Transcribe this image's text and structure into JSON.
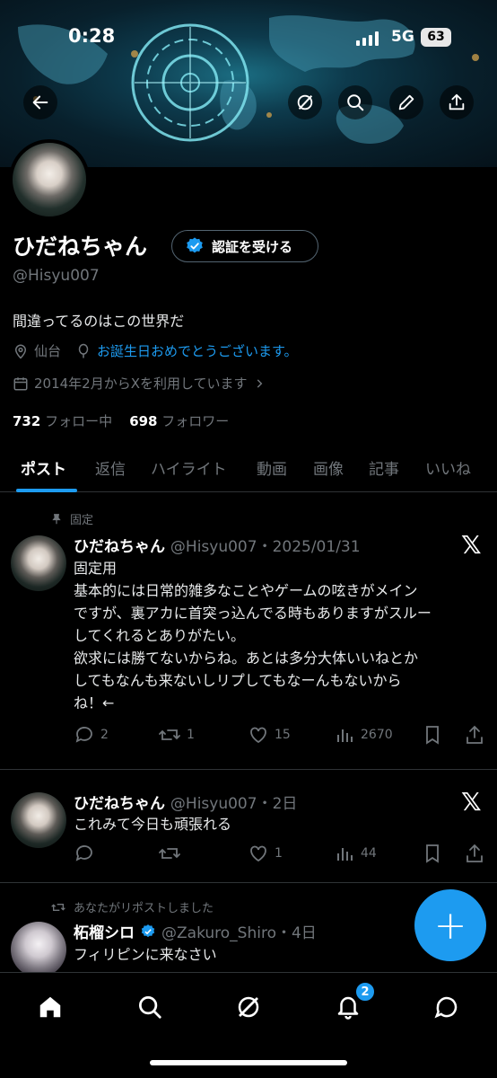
{
  "status": {
    "time": "0:28",
    "network": "5G",
    "battery": "63"
  },
  "profile": {
    "name": "ひだねちゃん",
    "verify_label": "認証を受ける",
    "handle": "@Hisyu007",
    "bio": "間違ってるのはこの世界だ",
    "location": "仙台",
    "birthday": "お誕生日おめでとうございます。",
    "joined": "2014年2月からXを利用しています",
    "following_count": "732",
    "following_label": "フォロー中",
    "followers_count": "698",
    "followers_label": "フォロワー"
  },
  "tabs": [
    "ポスト",
    "返信",
    "ハイライト",
    "動画",
    "画像",
    "記事",
    "いいね"
  ],
  "posts": [
    {
      "context": "固定",
      "name": "ひだねちゃん",
      "meta": "@Hisyu007・2025/01/31",
      "lines": [
        "固定用",
        "基本的には日常的雑多なことやゲームの呟きがメイン",
        "ですが、裏アカに首突っ込んでる時もありますがスルー",
        "してくれるとありがたい。",
        "欲求には勝てないからね。あとは多分大体いいねとか",
        "してもなんも来ないしリプしてもなーんもないから",
        "ね！←"
      ],
      "replies": "2",
      "reposts": "1",
      "likes": "15",
      "views": "2670"
    },
    {
      "name": "ひだねちゃん",
      "meta": "@Hisyu007・2日",
      "lines": [
        "これみて今日も頑張れる"
      ],
      "replies": "",
      "reposts": "",
      "likes": "1",
      "views": "44"
    },
    {
      "context": "あなたがリポストしました",
      "name": "柘榴シロ",
      "meta": "@Zakuro_Shiro・4日",
      "lines": [
        "フィリピンに来なさい"
      ]
    }
  ],
  "x_logo": "𝕏",
  "fab_label": "+",
  "nav": {
    "notifications_badge": "2"
  },
  "colors": {
    "accent": "#1d9bf0",
    "background": "#000000",
    "muted": "#71767b"
  },
  "icons": [
    "back-arrow-icon",
    "grok-icon",
    "search-icon",
    "pencil-icon",
    "share-icon",
    "pin-icon",
    "location-icon",
    "balloon-icon",
    "calendar-icon",
    "chevron-right-icon",
    "verified-badge-icon",
    "reply-icon",
    "repost-icon",
    "like-icon",
    "views-icon",
    "bookmark-icon",
    "home-icon",
    "notifications-icon",
    "messages-icon"
  ]
}
